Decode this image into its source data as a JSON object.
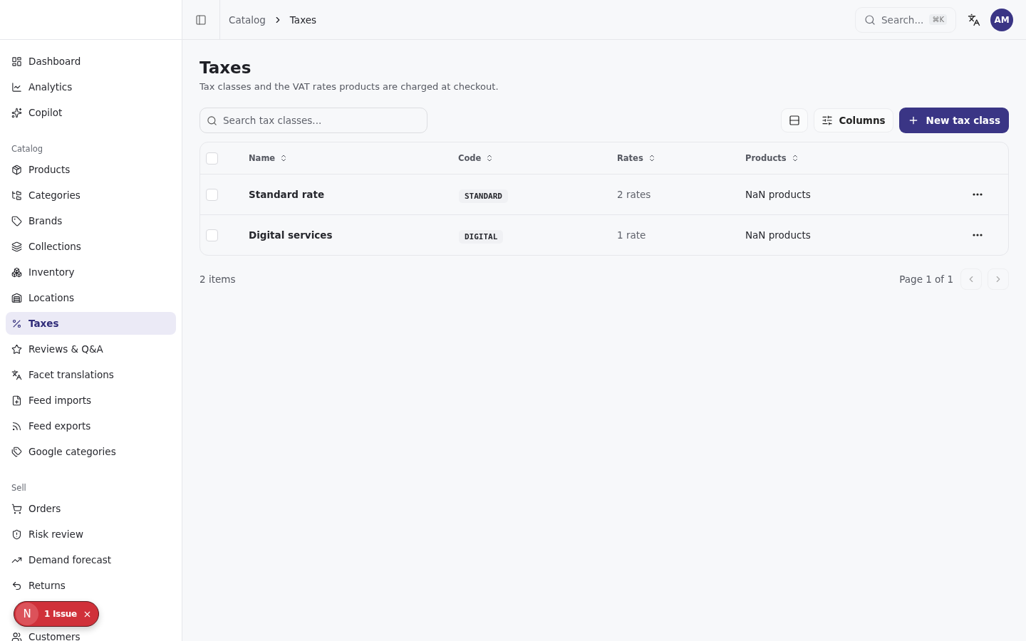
{
  "sidebar": {
    "groups": [
      {
        "items": [
          {
            "label": "Dashboard",
            "selected": false
          },
          {
            "label": "Analytics",
            "selected": false
          },
          {
            "label": "Copilot",
            "selected": false
          }
        ]
      },
      {
        "title": "Catalog",
        "items": [
          {
            "label": "Products",
            "selected": false
          },
          {
            "label": "Categories",
            "selected": false
          },
          {
            "label": "Brands",
            "selected": false
          },
          {
            "label": "Collections",
            "selected": false
          },
          {
            "label": "Inventory",
            "selected": false
          },
          {
            "label": "Locations",
            "selected": false
          },
          {
            "label": "Taxes",
            "selected": true
          },
          {
            "label": "Reviews & Q&A",
            "selected": false
          },
          {
            "label": "Facet translations",
            "selected": false
          },
          {
            "label": "Feed imports",
            "selected": false
          },
          {
            "label": "Feed exports",
            "selected": false
          },
          {
            "label": "Google categories",
            "selected": false
          }
        ]
      },
      {
        "title": "Sell",
        "items": [
          {
            "label": "Orders",
            "selected": false
          },
          {
            "label": "Risk review",
            "selected": false
          },
          {
            "label": "Demand forecast",
            "selected": false
          },
          {
            "label": "Returns",
            "selected": false
          },
          {
            "kind": "hidden"
          },
          {
            "label": "Customers",
            "selected": false
          }
        ]
      }
    ]
  },
  "breadcrumb": [
    "Catalog",
    "Taxes"
  ],
  "search": {
    "placeholder": "Search...",
    "shortcut": "⌘K"
  },
  "avatar": "AM",
  "page": {
    "title": "Taxes",
    "subtitle": "Tax classes and the VAT rates products are charged at checkout."
  },
  "filter": {
    "placeholder": "Search tax classes..."
  },
  "toolbar": {
    "columns": "Columns",
    "new": "New tax class"
  },
  "table": {
    "columns": [
      "Name",
      "Code",
      "Rates",
      "Products"
    ],
    "all_checked": false,
    "rows": [
      {
        "name": "Standard rate",
        "code": "STANDARD",
        "rates": "2 rates",
        "products": "NaN products",
        "checked": false
      },
      {
        "name": "Digital services",
        "code": "DIGITAL",
        "rates": "1 rate",
        "products": "NaN products",
        "checked": false
      }
    ]
  },
  "footer": {
    "count": "2 items",
    "page": "Page 1 of 1"
  },
  "toast": {
    "letter": "N",
    "label": "1 Issue"
  }
}
